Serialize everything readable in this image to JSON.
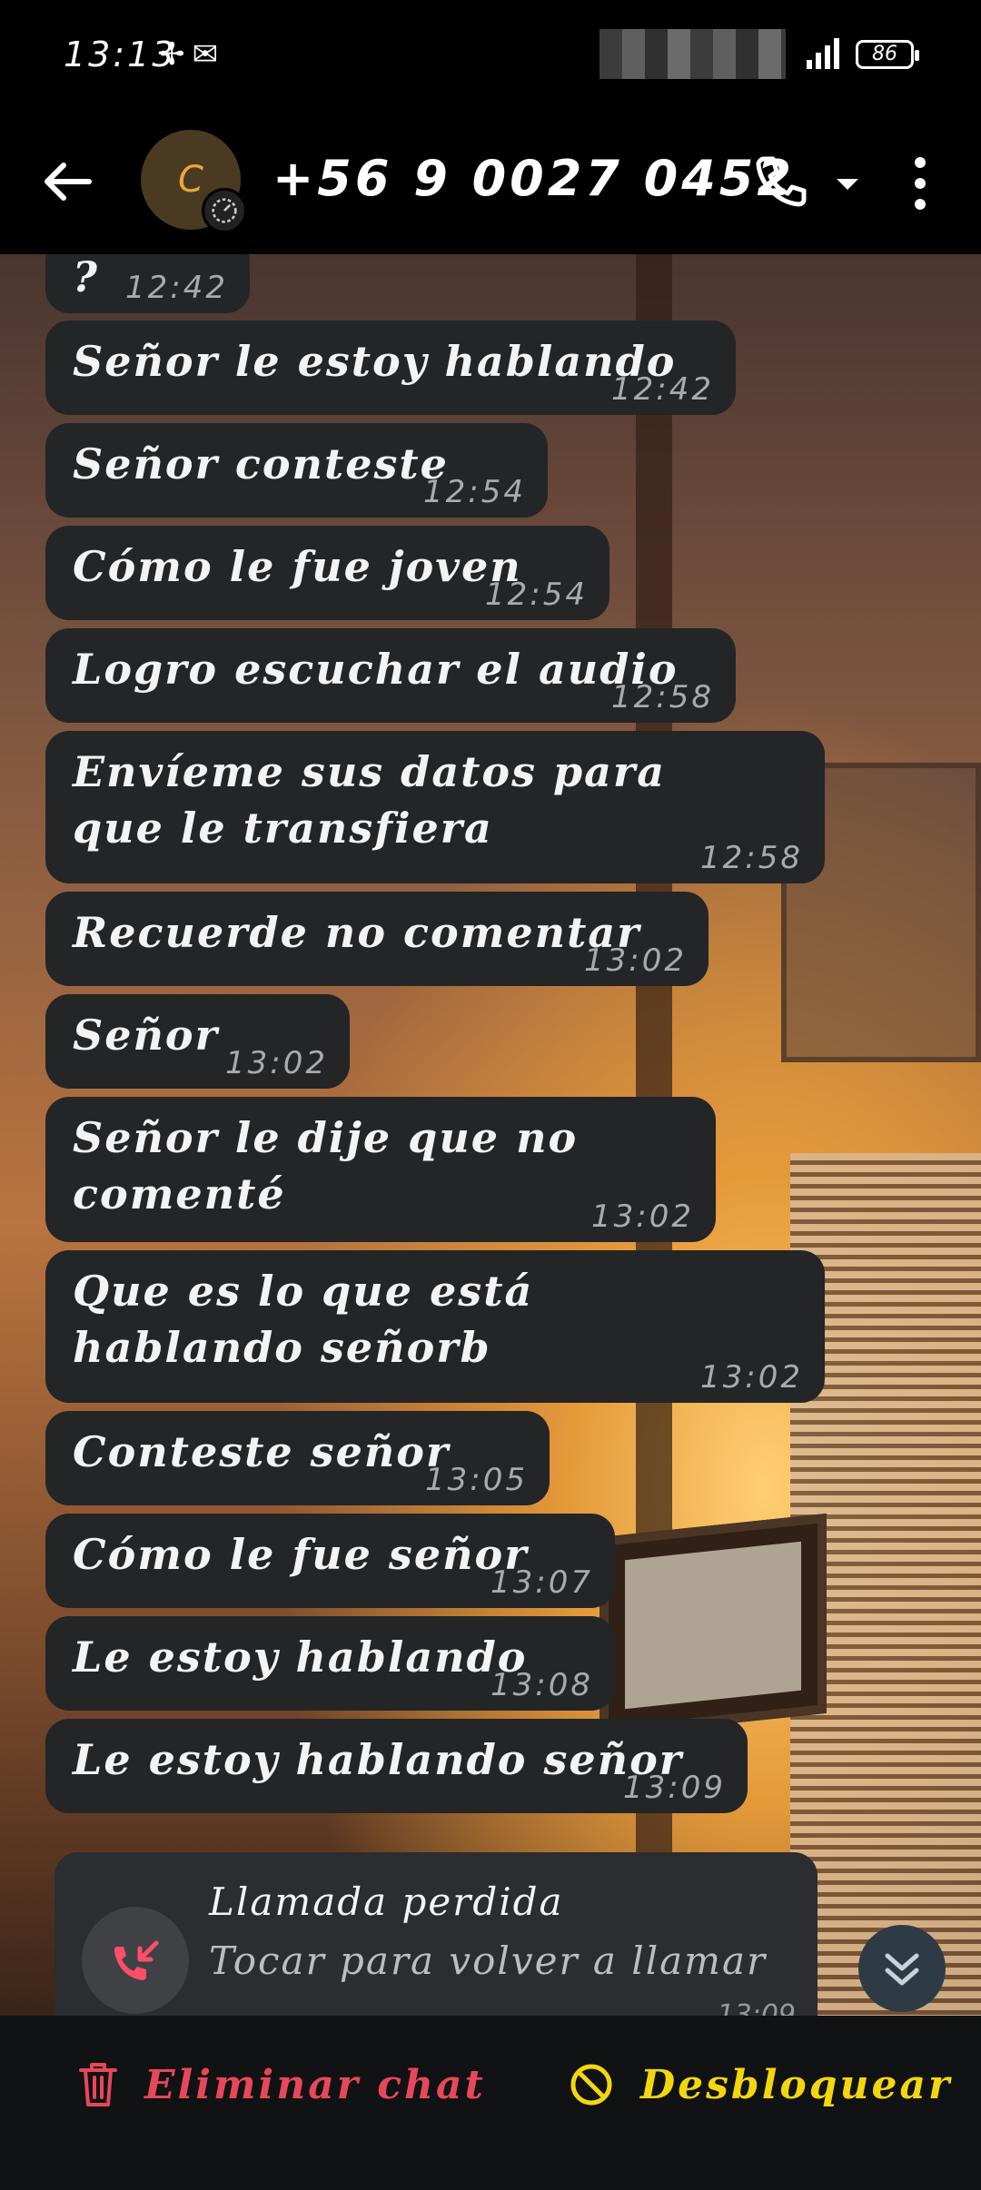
{
  "status_bar": {
    "time": "13:13",
    "battery": "86",
    "icons": [
      "fan-icon",
      "mail-icon",
      "signal-icon",
      "battery-icon"
    ]
  },
  "header": {
    "avatar_letter": "C",
    "contact": "+56 9 0027 0452"
  },
  "messages": [
    {
      "text": "?",
      "time": "12:42"
    },
    {
      "text": "Señor le estoy hablando",
      "time": "12:42"
    },
    {
      "text": "Señor conteste",
      "time": "12:54"
    },
    {
      "text": "Cómo le fue joven",
      "time": "12:54"
    },
    {
      "text": "Logro escuchar el audio",
      "time": "12:58"
    },
    {
      "text": "Envíeme sus datos para que le transfiera",
      "time": "12:58"
    },
    {
      "text": "Recuerde no comentar",
      "time": "13:02"
    },
    {
      "text": "Señor",
      "time": "13:02"
    },
    {
      "text": "Señor le dije que no comenté",
      "time": "13:02"
    },
    {
      "text": "Que es lo que está hablando señorb",
      "time": "13:02"
    },
    {
      "text": "Conteste señor",
      "time": "13:05"
    },
    {
      "text": "Cómo le fue señor",
      "time": "13:07"
    },
    {
      "text": "Le estoy hablando",
      "time": "13:08"
    },
    {
      "text": "Le estoy hablando señor",
      "time": "13:09"
    }
  ],
  "missed_call": {
    "title": "Llamada perdida",
    "subtitle": "Tocar para volver a llamar",
    "time": "13:09"
  },
  "actions": {
    "delete_label": "Eliminar chat",
    "unblock_label": "Desbloquear"
  },
  "colors": {
    "delete": "#e8475a",
    "unblock": "#f2d70c",
    "bubble": "#232527",
    "missed_icon": "#ff4d6a"
  }
}
